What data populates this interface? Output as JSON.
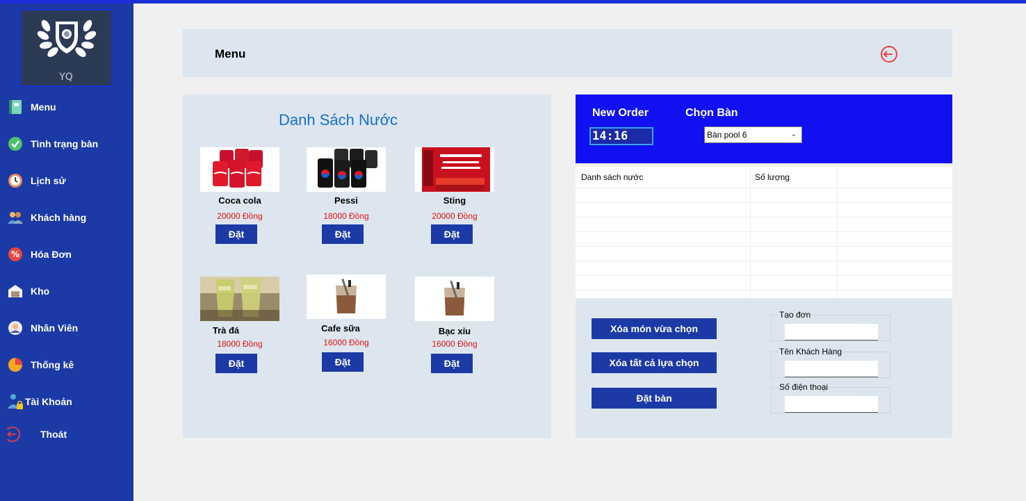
{
  "logo": {
    "text": "YQ"
  },
  "sidebar": {
    "items": [
      {
        "label": "Menu",
        "icon": "menu-book-icon"
      },
      {
        "label": "Tình trạng bàn",
        "icon": "check-circle-icon"
      },
      {
        "label": "Lịch sử",
        "icon": "history-clock-icon"
      },
      {
        "label": "Khách hàng",
        "icon": "customers-icon"
      },
      {
        "label": "Hóa Đơn",
        "icon": "invoice-percent-icon"
      },
      {
        "label": "Kho",
        "icon": "warehouse-icon"
      },
      {
        "label": "Nhân Viên",
        "icon": "employee-icon"
      },
      {
        "label": "Thống kê",
        "icon": "pie-chart-icon"
      },
      {
        "label": "Tài Khoản",
        "icon": "account-lock-icon"
      },
      {
        "label": "Thoát",
        "icon": "logout-icon"
      }
    ]
  },
  "header": {
    "title": "Menu",
    "exit_icon": "logout-icon"
  },
  "drinks": {
    "title": "Danh Sách Nước",
    "items": [
      {
        "name": "Coca cola",
        "price": "20000 Đồng",
        "button": "Đặt"
      },
      {
        "name": "Pessi",
        "price": "18000 Đồng",
        "button": "Đặt"
      },
      {
        "name": "Sting",
        "price": "20000 Đồng",
        "button": "Đặt"
      },
      {
        "name": "Trà đá",
        "price": "18000 Đồng",
        "button": "Đặt"
      },
      {
        "name": "Cafe sữa",
        "price": "16000 Đồng",
        "button": "Đặt"
      },
      {
        "name": "Bạc xỉu",
        "price": "16000 Đồng",
        "button": "Đặt"
      }
    ]
  },
  "order": {
    "new_order_label": "New Order",
    "choose_table_label": "Chọn Bàn",
    "time": "14:16",
    "table_selected": "Bàn pool 6",
    "columns": [
      "Danh sách nước",
      "Số lượng"
    ]
  },
  "actions": {
    "remove_selected": "Xóa món vừa chọn",
    "remove_all": "Xóa tất cả lựa chọn",
    "book_table": "Đặt bàn"
  },
  "form": {
    "create_order_label": "Tạo đơn",
    "customer_name_label": "Tên Khách Hàng",
    "phone_label": "Số điện thoại"
  },
  "colors": {
    "sidebar": "#1c3aa5",
    "accent_blue": "#1010f0",
    "panel": "#dde6ef",
    "price_red": "#e01010",
    "title_blue": "#1670c8"
  }
}
